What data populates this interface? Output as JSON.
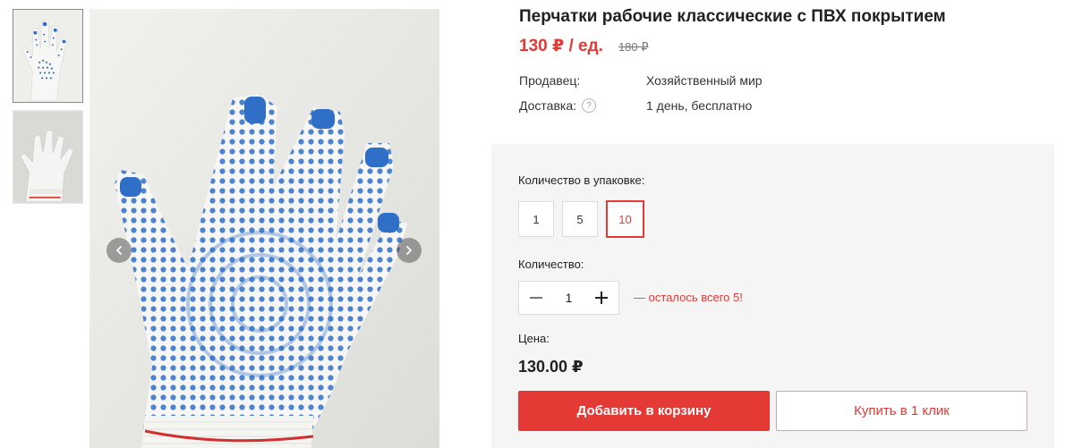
{
  "product": {
    "title": "Перчатки рабочие классические с ПВХ покрытием",
    "price_current": "130 ₽ / ед.",
    "price_old": "180 ₽"
  },
  "specs": [
    {
      "label": "Продавец:",
      "value": "Хозяйственный мир"
    },
    {
      "label": "Доставка:",
      "value": "1 день, бесплатно"
    }
  ],
  "gallery": {
    "thumbnails": [
      "glove-blue-dots-thumb",
      "glove-white-thumb"
    ],
    "active_index": 0
  },
  "purchase": {
    "pack_label": "Количество в упаковке:",
    "pack_options": [
      "1",
      "5",
      "10"
    ],
    "pack_selected": "10",
    "qty_label": "Количество:",
    "qty_value": "1",
    "stock_note": "— осталось всего 5!",
    "price_label": "Цена:",
    "price_total": "130.00 ₽",
    "add_to_cart": "Добавить в корзину",
    "buy_one_click": "Купить в 1 клик"
  },
  "icons": {
    "prev": "chevron-left-icon",
    "next": "chevron-right-icon",
    "help": "question-icon",
    "minus": "minus-icon",
    "plus": "plus-icon"
  },
  "colors": {
    "accent": "#e53935",
    "panel_bg": "#f5f5f6",
    "dots": "#2f6fc8"
  }
}
